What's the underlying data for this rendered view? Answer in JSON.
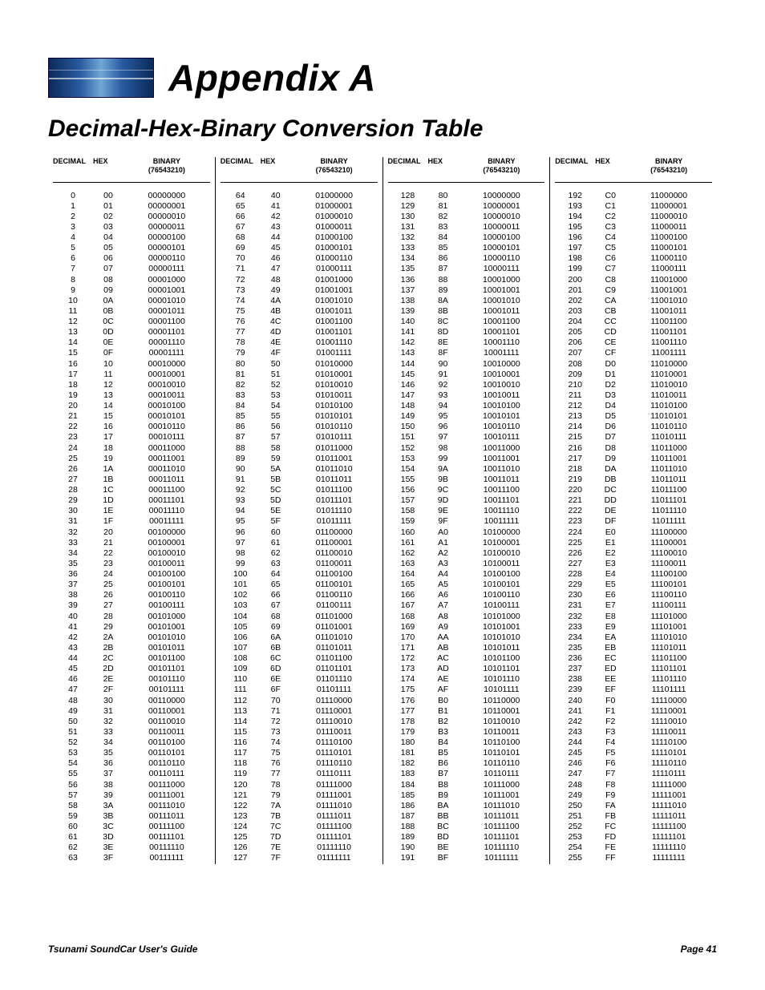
{
  "title_line1": "Appendix A",
  "title_line2": "Decimal-Hex-Binary Conversion Table",
  "header_decimal": "DECIMAL",
  "header_hex": "HEX",
  "header_binary_line1": "BINARY",
  "header_binary_line2": "(76543210)",
  "footer_left": "Tsunami SoundCar User's Guide",
  "footer_right": "Page 41",
  "chart_data": {
    "type": "table",
    "columns": [
      "DECIMAL",
      "HEX",
      "BINARY (76543210)"
    ],
    "group_ranges": [
      [
        0,
        63
      ],
      [
        64,
        127
      ],
      [
        128,
        191
      ],
      [
        192,
        255
      ]
    ]
  }
}
